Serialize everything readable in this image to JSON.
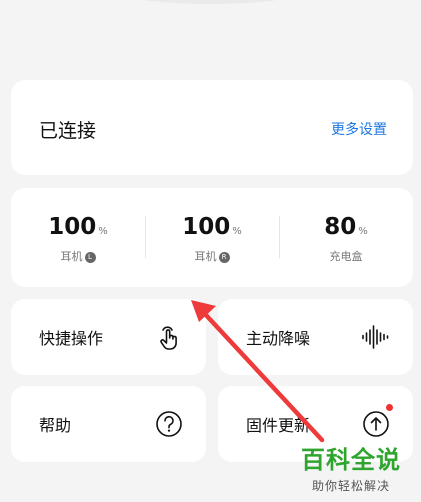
{
  "connection": {
    "status": "已连接",
    "more_settings": "更多设置"
  },
  "battery": [
    {
      "value": "100",
      "unit": "%",
      "label": "耳机",
      "badge": "L"
    },
    {
      "value": "100",
      "unit": "%",
      "label": "耳机",
      "badge": "R"
    },
    {
      "value": "80",
      "unit": "%",
      "label": "充电盒",
      "badge": ""
    }
  ],
  "tiles": {
    "shortcut": {
      "label": "快捷操作",
      "icon": "touch-gesture-icon"
    },
    "anc": {
      "label": "主动降噪",
      "icon": "sound-wave-icon"
    },
    "help": {
      "label": "帮助",
      "icon": "question-circle-icon"
    },
    "firmware": {
      "label": "固件更新",
      "icon": "upload-circle-icon",
      "has_update_dot": true
    }
  },
  "annotation": {
    "arrow_color": "#ee3a3a"
  },
  "watermark": {
    "title": "百科全说",
    "subtitle": "助你轻松解决",
    "color": "#2fa52f"
  },
  "colors": {
    "accent": "#1d77e2",
    "background": "#f4f4f4",
    "card": "#ffffff"
  }
}
